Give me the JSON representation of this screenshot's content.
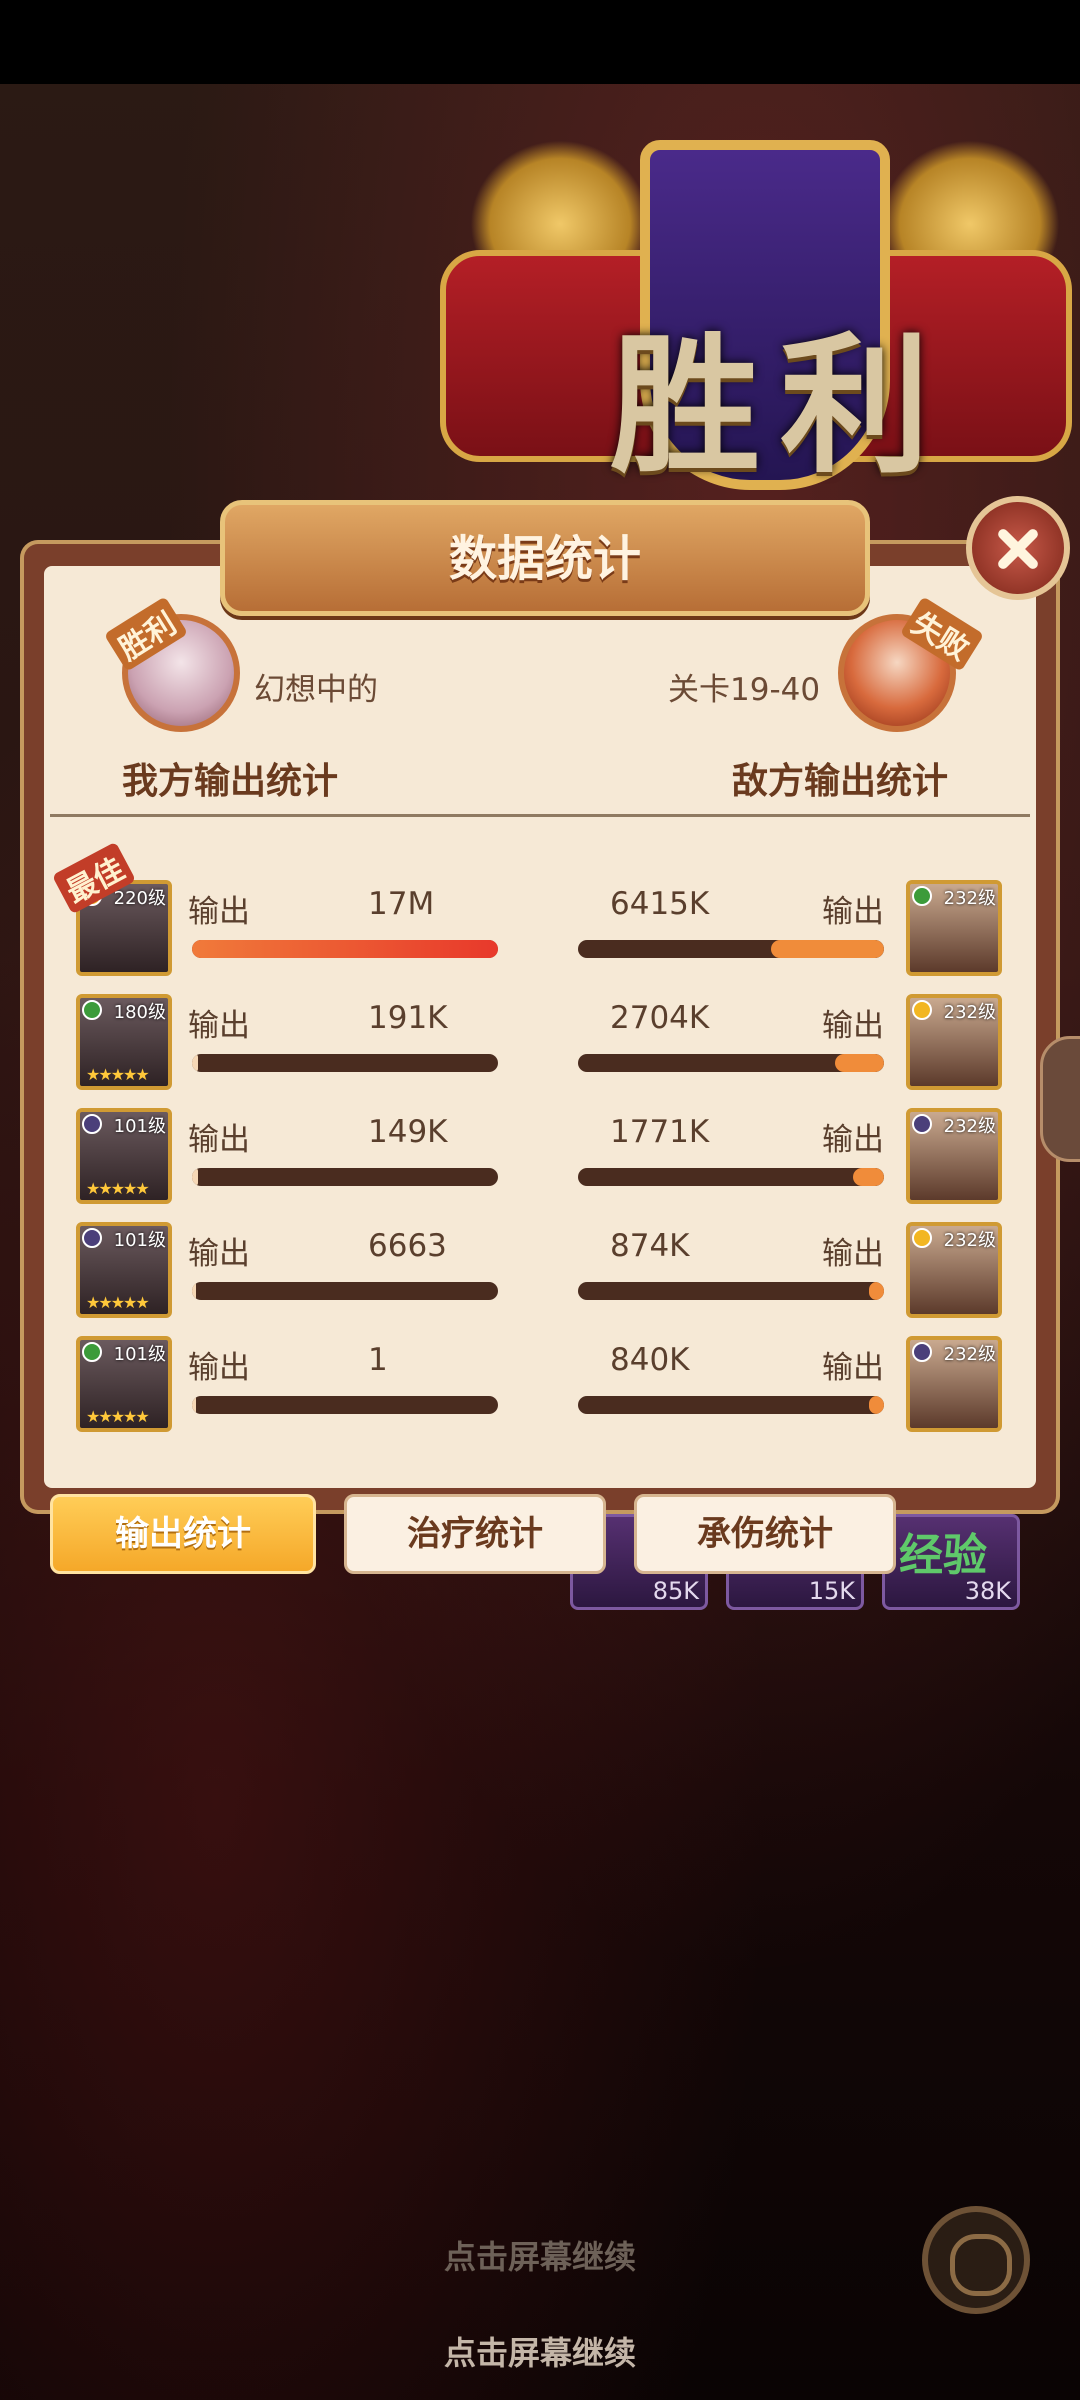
{
  "victory_banner": {
    "text": "胜利"
  },
  "panel": {
    "title": "数据统计"
  },
  "header": {
    "left": {
      "badge": "胜利",
      "name": "幻想中的",
      "title": "我方输出统计"
    },
    "right": {
      "badge": "失败",
      "stage": "关卡19-40",
      "title": "敌方输出统计"
    }
  },
  "best_badge": "最佳",
  "colors": {
    "fill_red": "#e8392b",
    "fill_orange": "#f08c3a",
    "gold_border": "#d09a33"
  },
  "ally_rows": [
    {
      "level": "220级",
      "label": "输出",
      "value": "17M",
      "ratio": 1.0,
      "element": "light",
      "stars": ""
    },
    {
      "level": "180级",
      "label": "输出",
      "value": "191K",
      "ratio": 0.011,
      "element": "wind",
      "stars": "★★★★★"
    },
    {
      "level": "101级",
      "label": "输出",
      "value": "149K",
      "ratio": 0.009,
      "element": "dark",
      "stars": "★★★★★"
    },
    {
      "level": "101级",
      "label": "输出",
      "value": "6663",
      "ratio": 0.0,
      "element": "dark",
      "stars": "★★★★★"
    },
    {
      "level": "101级",
      "label": "输出",
      "value": "1",
      "ratio": 0.0,
      "element": "wind",
      "stars": "★★★★★"
    }
  ],
  "enemy_rows": [
    {
      "level": "232级",
      "label": "输出",
      "value": "6415K",
      "ratio": 0.37,
      "element": "wind"
    },
    {
      "level": "232级",
      "label": "输出",
      "value": "2704K",
      "ratio": 0.16,
      "element": "light"
    },
    {
      "level": "232级",
      "label": "输出",
      "value": "1771K",
      "ratio": 0.1,
      "element": "dark"
    },
    {
      "level": "232级",
      "label": "输出",
      "value": "874K",
      "ratio": 0.05,
      "element": "light"
    },
    {
      "level": "232级",
      "label": "输出",
      "value": "840K",
      "ratio": 0.05,
      "element": "dark"
    }
  ],
  "tabs": [
    {
      "label": "输出统计",
      "active": true
    },
    {
      "label": "治疗统计",
      "active": false
    },
    {
      "label": "承伤统计",
      "active": false
    }
  ],
  "rewards": [
    {
      "value": "85K"
    },
    {
      "value": "15K"
    },
    {
      "value": "38K",
      "label": "经验"
    }
  ],
  "continue_text": "点击屏幕继续"
}
